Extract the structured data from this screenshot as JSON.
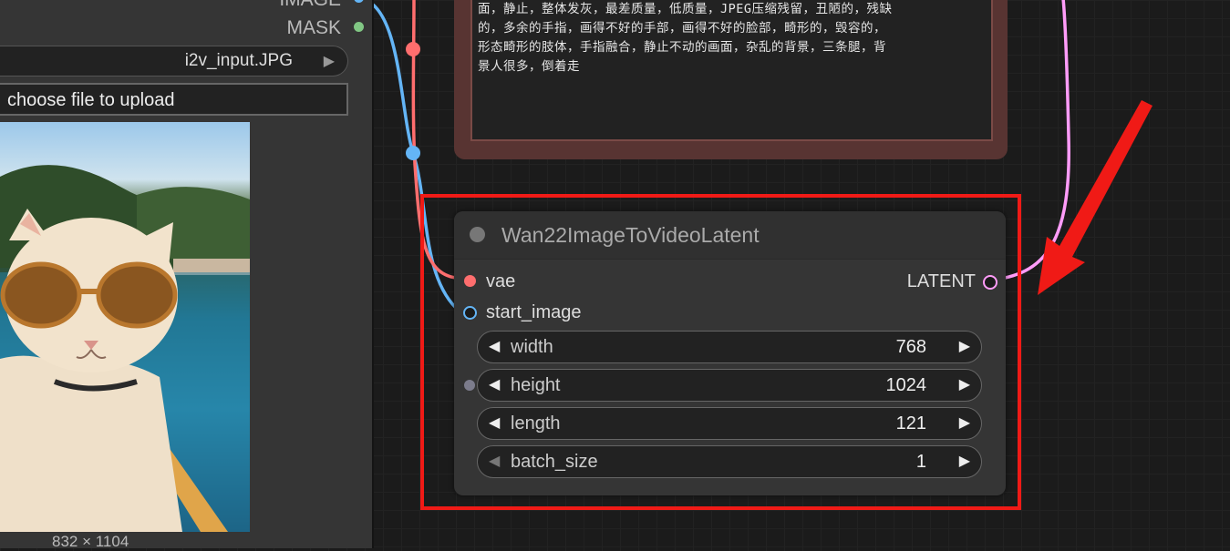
{
  "load_image_node": {
    "outputs": [
      {
        "label": "IMAGE",
        "color": "#64b5f6"
      },
      {
        "label": "MASK",
        "color": "#81c784"
      }
    ],
    "image_combo": {
      "value": "i2v_input.JPG"
    },
    "upload_button": {
      "label": "choose file to upload"
    },
    "image_size": "832 × 1104"
  },
  "prompt_node": {
    "text_lines": [
      "面，静止，整体发灰，最差质量，低质量，JPEG压缩残留，丑陋的，残缺",
      "的，多余的手指，画得不好的手部，画得不好的脸部，畸形的，毁容的，",
      "形态畸形的肢体，手指融合，静止不动的画面，杂乱的背景，三条腿，背",
      "景人很多，倒着走"
    ],
    "bg_color": "#583432"
  },
  "wan_node": {
    "title": "Wan22ImageToVideoLatent",
    "inputs": [
      {
        "label": "vae",
        "color": "#ff6e6e"
      },
      {
        "label": "start_image",
        "color": "#64b5f6"
      }
    ],
    "output": {
      "label": "LATENT",
      "color": "#ff9cf9"
    },
    "widgets": [
      {
        "name": "width",
        "value": "768"
      },
      {
        "name": "height",
        "value": "1024"
      },
      {
        "name": "length",
        "value": "121"
      },
      {
        "name": "batch_size",
        "value": "1"
      }
    ]
  },
  "annotation": {
    "box_color": "#f01a16",
    "arrow_color": "#f01a16"
  },
  "links": {
    "vae_color": "#ff6e6e",
    "image_color": "#64b5f6",
    "latent_color": "#ff9cf9"
  }
}
